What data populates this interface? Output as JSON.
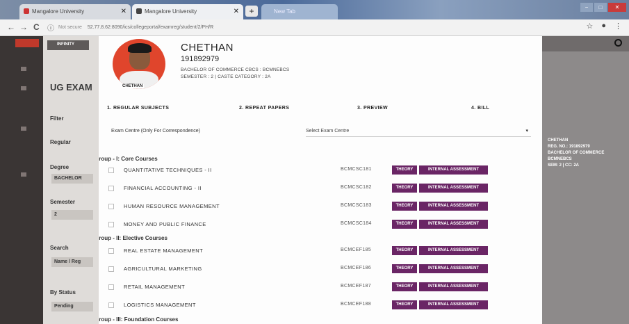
{
  "browser": {
    "tabs": [
      {
        "title": "Mangalore University"
      },
      {
        "title": "Mangalore University"
      },
      {
        "title": "New Tab"
      }
    ],
    "new_tab": "+",
    "url_prefix": "Not secure",
    "url": "52.77.8.62:8090/ics/collegeportal/examreg/student/2/PH/R",
    "back": "←",
    "forward": "→",
    "reload": "C",
    "info": "ⓘ",
    "star": "☆",
    "profile": "●",
    "menu": "⋮",
    "win_min": "−",
    "win_max": "□",
    "win_close": "✕"
  },
  "background_app": {
    "brand": "INFINITY",
    "section": "UG EXAM",
    "filter": "Filter",
    "regular": "Regular",
    "degree_label": "Degree",
    "degree_value": "BACHELOR",
    "semester_label": "Semester",
    "semester_value": "2",
    "search_label": "Search",
    "search_value": "Name / Reg",
    "status_label": "By Status",
    "status_value": "Pending",
    "right_info": [
      "CHETHAN",
      "REG. NO.: 191892979",
      "BACHELOR OF COMMERCE",
      "BCMNEBCS",
      "SEM: 2 | CC: 2A"
    ]
  },
  "student": {
    "name": "CHETHAN",
    "reg_no": "191892979",
    "degree": "BACHELOR OF COMMERCE CBCS : BCMNEBCS",
    "semester": "SEMESTER : 2 | CASTE CATEGORY : 2A",
    "photo_caption": "CHETHAN"
  },
  "steps": [
    "1. REGULAR SUBJECTS",
    "2. REPEAT PAPERS",
    "3. PREVIEW",
    "4. BILL"
  ],
  "exam_centre": {
    "label": "Exam Centre (Only For Correspondence)",
    "placeholder": "Select Exam Centre",
    "caret": "▾"
  },
  "groups": [
    {
      "title": "Group - I: Core Courses",
      "subjects": [
        {
          "name": "QUANTITATIVE TECHNIQUES - II",
          "code": "BCMCSC181"
        },
        {
          "name": "FINANCIAL ACCOUNTING - II",
          "code": "BCMCSC182"
        },
        {
          "name": "HUMAN RESOURCE MANAGEMENT",
          "code": "BCMCSC183"
        },
        {
          "name": "MONEY AND PUBLIC FINANCE",
          "code": "BCMCSC184"
        }
      ]
    },
    {
      "title": "Group - II: Elective Courses",
      "subjects": [
        {
          "name": "REAL ESTATE MANAGEMENT",
          "code": "BCMCEF185"
        },
        {
          "name": "AGRICULTURAL MARKETING",
          "code": "BCMCEF186"
        },
        {
          "name": "RETAIL MANAGEMENT",
          "code": "BCMCEF187"
        },
        {
          "name": "LOGISTICS MANAGEMENT",
          "code": "BCMCEF188"
        }
      ]
    },
    {
      "title": "Group - III: Foundation Courses",
      "subjects": []
    }
  ],
  "labels": {
    "theory": "THEORY",
    "internal": "INTERNAL ASSESSMENT"
  },
  "colors": {
    "accent": "#6a2565",
    "avatar_bg": "#e0452c"
  }
}
